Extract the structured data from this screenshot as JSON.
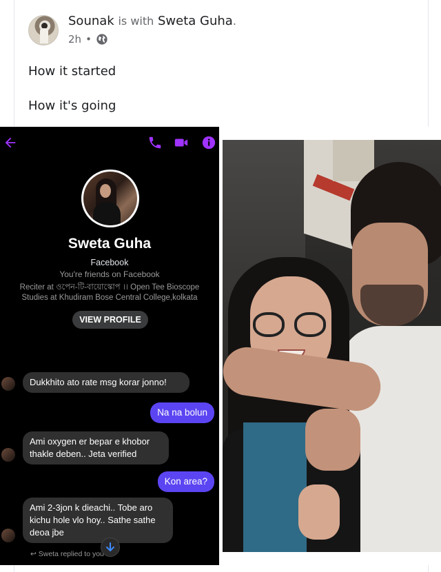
{
  "post": {
    "author": "Sounak",
    "connector": "is with",
    "tagged": "Sweta Guha",
    "end_punct": ".",
    "time": "2h",
    "separator": "•",
    "privacy_icon": "globe-icon",
    "line1": "How it started",
    "line2": "How it's going"
  },
  "messenger": {
    "icons": [
      "back-arrow-icon",
      "phone-icon",
      "video-camera-icon",
      "info-icon"
    ],
    "accent_color": "#a033ff",
    "profile": {
      "name": "Sweta Guha",
      "platform": "Facebook",
      "friends_text": "You're friends on Facebook",
      "work": "Reciter at ওপেন-টি-বায়োস্কোপ ।। Open Tee Bioscope",
      "studies": "Studies at Khudiram Bose Central College,kolkata",
      "view_profile_label": "VIEW PROFILE"
    },
    "messages": [
      {
        "from": "them",
        "text": "Dukkhito ato rate msg korar jonno!"
      },
      {
        "from": "me",
        "text": "Na na bolun"
      },
      {
        "from": "them",
        "text": "Ami oxygen er bepar e khobor thakle deben.. Jeta verified"
      },
      {
        "from": "me",
        "text": "Kon area?"
      },
      {
        "from": "them",
        "text": "Ami 2-3jon k dieachi.. Tobe aro kichu hole vlo hoy.. Sathe sathe deoa jbe"
      }
    ],
    "replied_note": "Sweta replied to you",
    "out_bubble_color": "#5b45f2"
  }
}
